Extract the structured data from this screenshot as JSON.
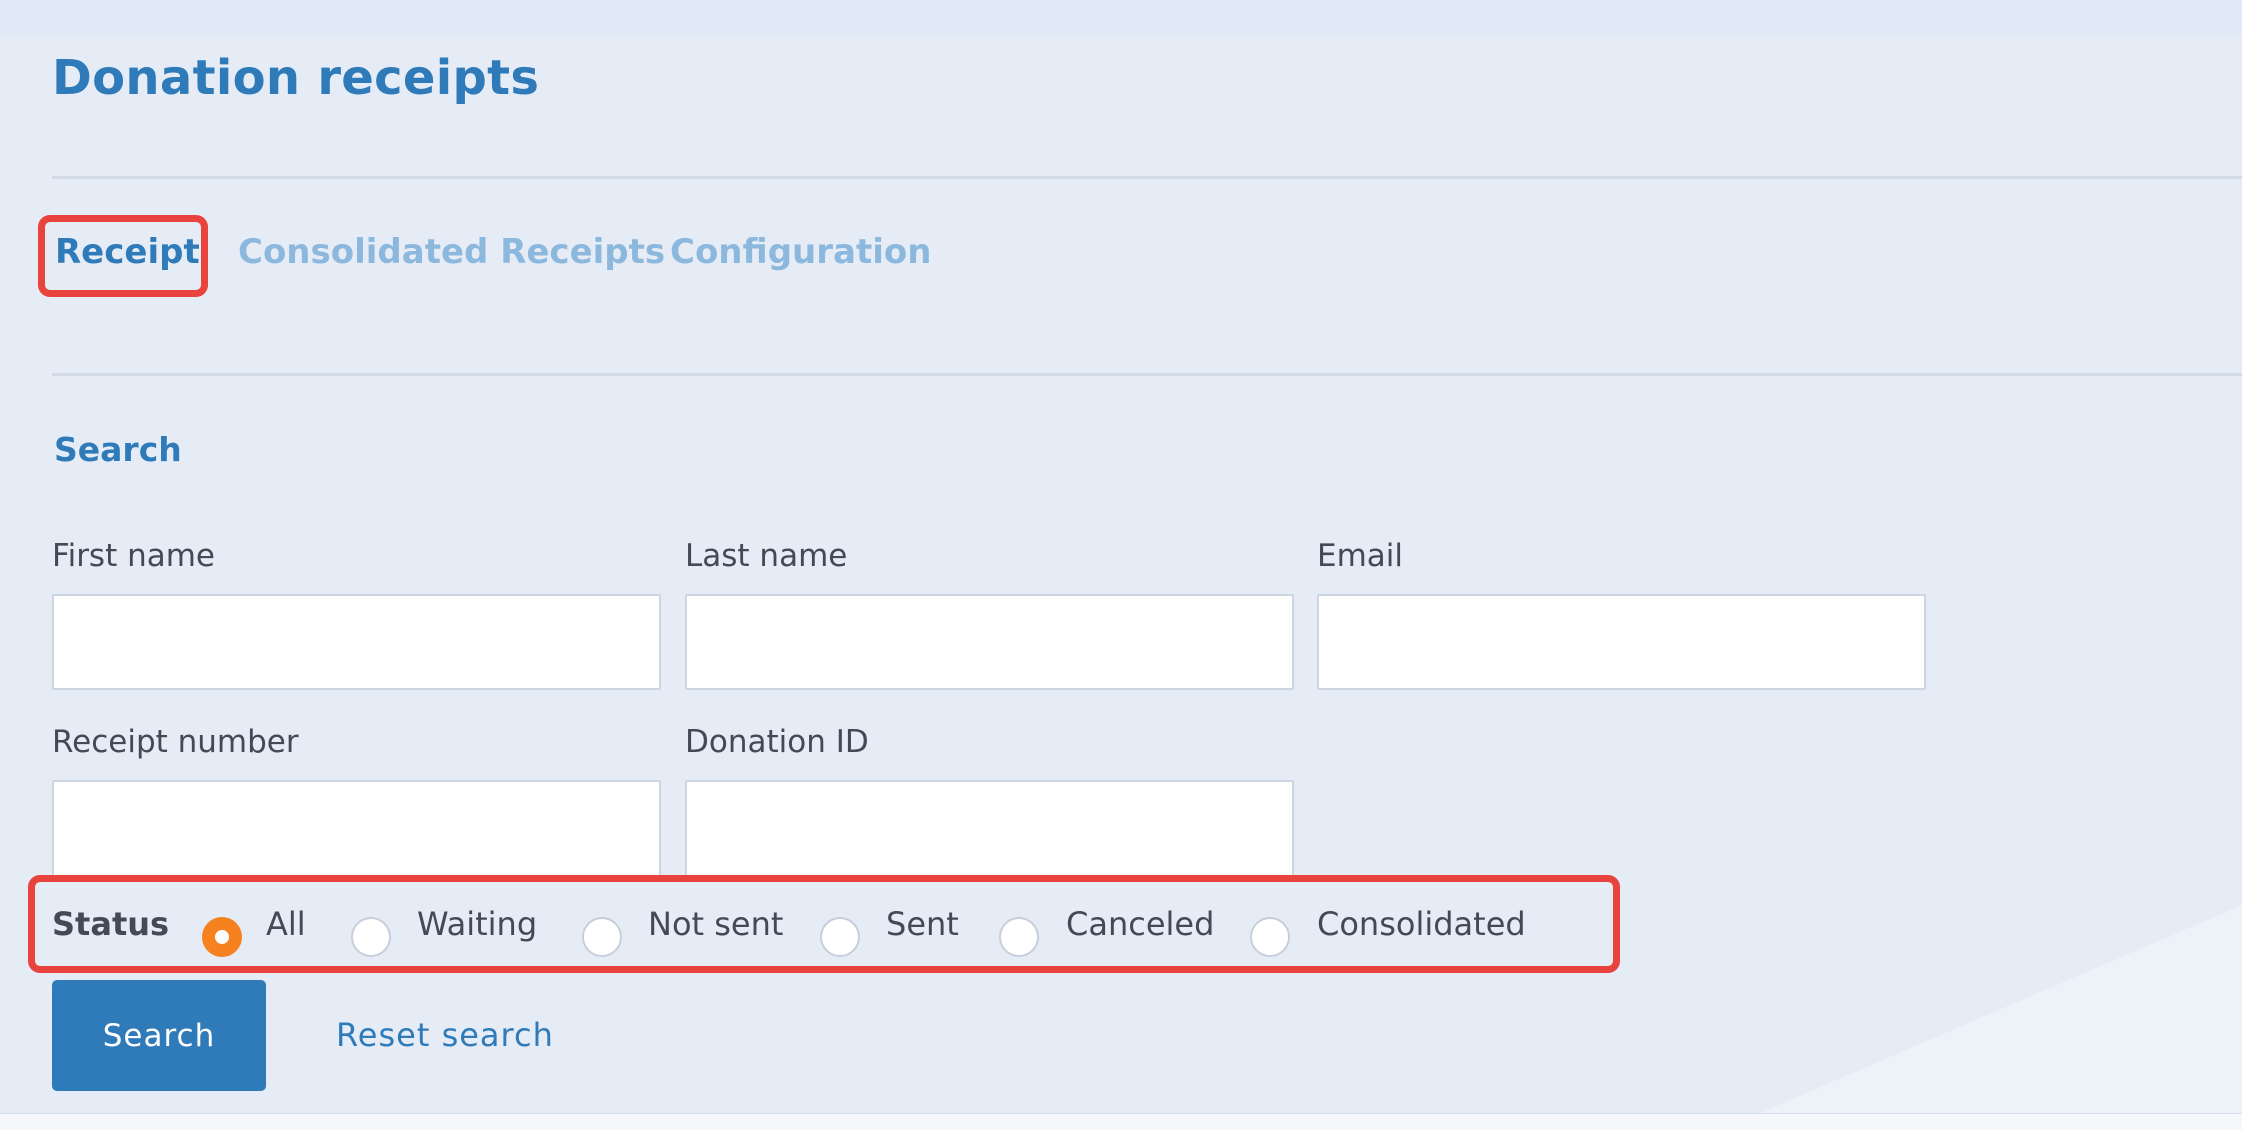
{
  "page": {
    "title": "Donation receipts"
  },
  "tabs": [
    {
      "label": "Receipt",
      "active": true
    },
    {
      "label": "Consolidated Receipts",
      "active": false
    },
    {
      "label": "Configuration",
      "active": false
    }
  ],
  "search": {
    "section_title": "Search",
    "fields": {
      "first_name": {
        "label": "First name",
        "value": "",
        "placeholder": ""
      },
      "last_name": {
        "label": "Last name",
        "value": "",
        "placeholder": ""
      },
      "email": {
        "label": "Email",
        "value": "",
        "placeholder": ""
      },
      "receipt_number": {
        "label": "Receipt number",
        "value": "",
        "placeholder": ""
      },
      "donation_id": {
        "label": "Donation ID",
        "value": "",
        "placeholder": ""
      }
    },
    "status": {
      "label": "Status",
      "selected": "All",
      "options": [
        "All",
        "Waiting",
        "Not sent",
        "Sent",
        "Canceled",
        "Consolidated"
      ]
    },
    "search_button": "Search",
    "reset_link": "Reset search"
  },
  "colors": {
    "accent": "#2f7ab8",
    "tab_inactive": "#8db8de",
    "radio_selected": "#f5821f",
    "highlight": "#e8433c",
    "background": "#e5ecf6"
  }
}
